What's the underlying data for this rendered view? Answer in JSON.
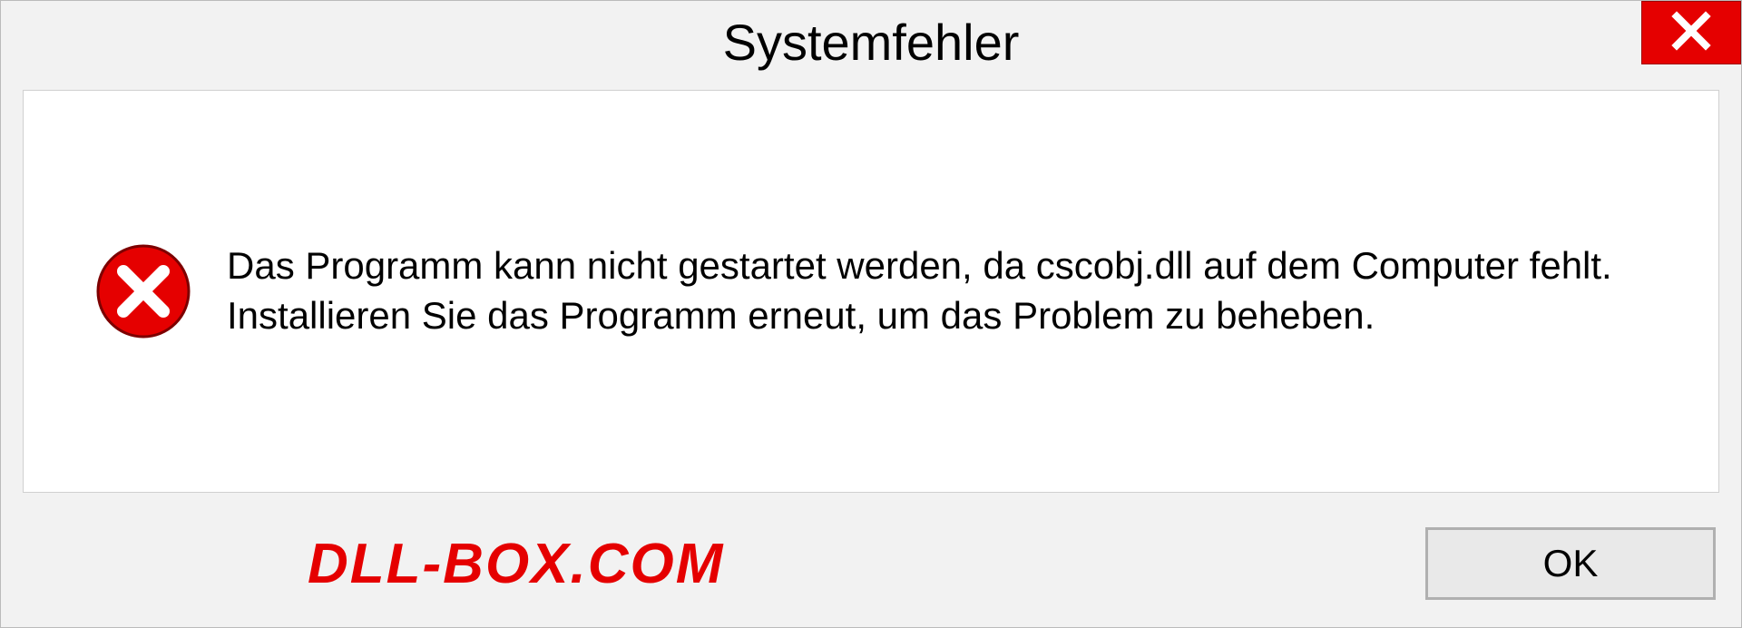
{
  "dialog": {
    "title": "Systemfehler",
    "message": "Das Programm kann nicht gestartet werden, da cscobj.dll auf dem Computer fehlt. Installieren Sie das Programm erneut, um das Problem zu beheben.",
    "ok_label": "OK"
  },
  "watermark": "DLL-BOX.COM"
}
